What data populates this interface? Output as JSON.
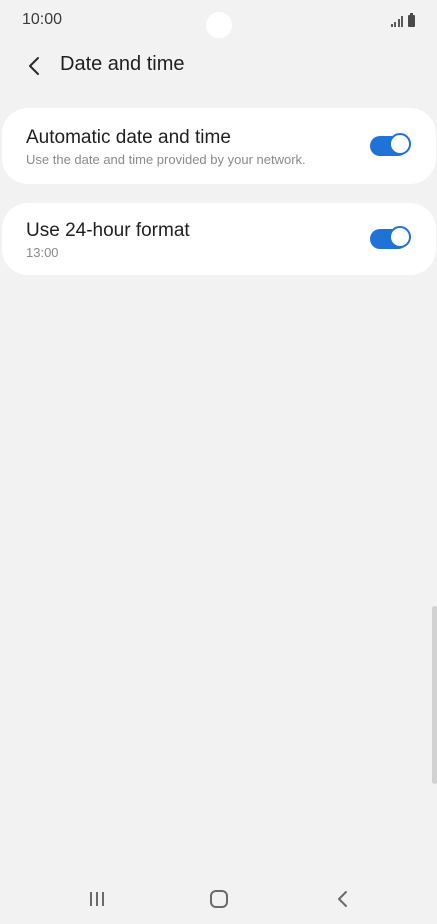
{
  "status_bar": {
    "time": "10:00"
  },
  "header": {
    "title": "Date and time"
  },
  "settings": [
    {
      "title": "Automatic date and time",
      "subtitle": "Use the date and time provided by your network.",
      "enabled": true
    },
    {
      "title": "Use 24-hour format",
      "subtitle": "13:00",
      "enabled": true
    }
  ],
  "icons": {
    "back": "chevron-left-icon",
    "signal": "signal-icon",
    "battery": "battery-icon",
    "recents": "recents-icon",
    "home": "home-icon",
    "nav_back": "back-icon"
  },
  "colors": {
    "accent": "#1f72d6",
    "background": "#f2f2f2",
    "card": "#ffffff"
  }
}
